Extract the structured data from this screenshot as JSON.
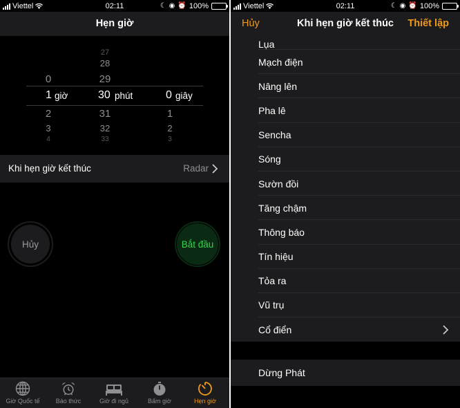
{
  "status_left": {
    "carrier": "Viettel",
    "time": "02:11",
    "battery": "100%"
  },
  "status_right": {
    "carrier": "Viettel",
    "time": "02:11",
    "battery": "100%"
  },
  "timer": {
    "title": "Hẹn giờ",
    "picker": {
      "hours": {
        "above": [
          "0"
        ],
        "selected": "1",
        "unit": "giờ",
        "below": [
          "2",
          "3",
          "4"
        ]
      },
      "minutes": {
        "above": [
          "27",
          "28",
          "29"
        ],
        "selected": "30",
        "unit": "phút",
        "below": [
          "31",
          "32",
          "33"
        ]
      },
      "seconds": {
        "above": [],
        "selected": "0",
        "unit": "giây",
        "below": [
          "1",
          "2",
          "3"
        ]
      }
    },
    "when_done_label": "Khi hẹn giờ kết thúc",
    "when_done_value": "Radar",
    "cancel_label": "Hủy",
    "start_label": "Bắt đầu"
  },
  "tabs": [
    {
      "label": "Giờ Quốc tế",
      "icon": "globe-icon",
      "active": false
    },
    {
      "label": "Báo thức",
      "icon": "alarm-clock-icon",
      "active": false
    },
    {
      "label": "Giờ đi ngủ",
      "icon": "bed-icon",
      "active": false
    },
    {
      "label": "Bấm giờ",
      "icon": "stopwatch-icon",
      "active": false
    },
    {
      "label": "Hẹn giờ",
      "icon": "timer-icon",
      "active": true
    }
  ],
  "sound_picker": {
    "cancel_label": "Hủy",
    "title": "Khi hẹn giờ kết thúc",
    "set_label": "Thiết lập",
    "items": [
      "Lụa",
      "Mạch điện",
      "Nâng lên",
      "Pha lê",
      "Sencha",
      "Sóng",
      "Sườn đồi",
      "Tăng chậm",
      "Thông báo",
      "Tín hiệu",
      "Tỏa ra",
      "Vũ trụ"
    ],
    "classic_label": "Cổ điển",
    "stop_playing_label": "Dừng Phát"
  },
  "colors": {
    "accent": "#f09a1a",
    "start_green": "#32d74b",
    "background": "#000000",
    "cell": "#1c1c1e"
  }
}
